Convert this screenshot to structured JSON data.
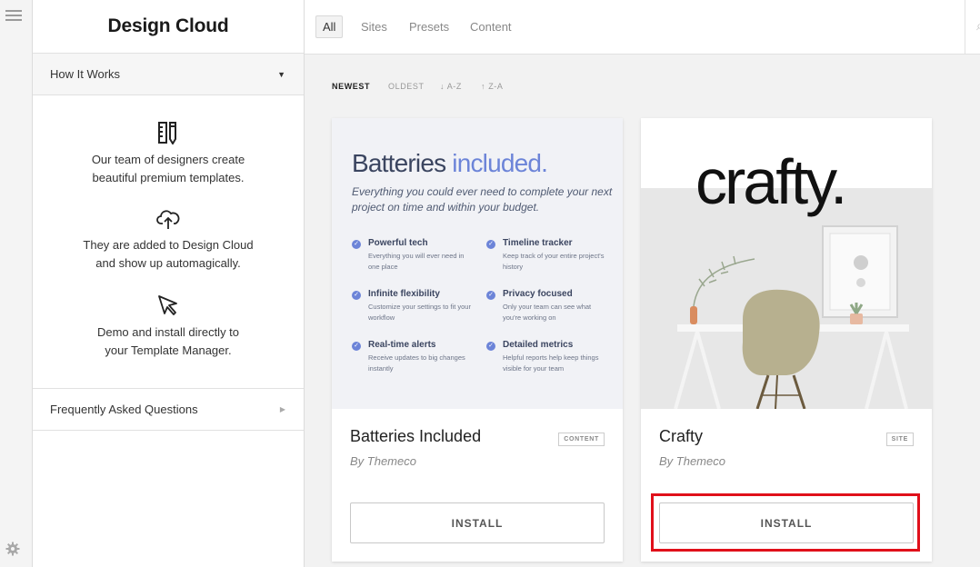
{
  "sidebar": {
    "title": "Design Cloud",
    "how_it_works": "How It Works",
    "steps": [
      {
        "icon": "ruler-pencil-icon",
        "text_line1": "Our team of designers create",
        "text_line2": "beautiful premium templates."
      },
      {
        "icon": "cloud-upload-icon",
        "text_line1": "They are added to Design Cloud",
        "text_line2": "and show up automagically."
      },
      {
        "icon": "cursor-arrow-icon",
        "text_line1": "Demo and install directly to",
        "text_line2": "your Template Manager."
      }
    ],
    "faq": "Frequently Asked Questions"
  },
  "filters": {
    "tabs": [
      "All",
      "Sites",
      "Presets",
      "Content"
    ],
    "active_tab": "All"
  },
  "sort": {
    "options": [
      "NEWEST",
      "OLDEST",
      "↓ A-Z",
      "↑ Z-A"
    ],
    "active": "NEWEST"
  },
  "cards": [
    {
      "title": "Batteries Included",
      "badge": "CONTENT",
      "author": "By Themeco",
      "button": "INSTALL",
      "preview": {
        "heading_part1": "Batteries",
        "heading_part2": "included.",
        "subheading": "Everything you could ever need to complete your next project on time and within your budget.",
        "features": [
          {
            "title": "Powerful tech",
            "desc": "Everything you will ever need in one place"
          },
          {
            "title": "Timeline tracker",
            "desc": "Keep track of your entire project's history"
          },
          {
            "title": "Infinite flexibility",
            "desc": "Customize your settings to fit your workflow"
          },
          {
            "title": "Privacy focused",
            "desc": "Only your team can see what you're working on"
          },
          {
            "title": "Real-time alerts",
            "desc": "Receive updates to big changes instantly"
          },
          {
            "title": "Detailed metrics",
            "desc": "Helpful reports help keep things visible for your team"
          }
        ]
      }
    },
    {
      "title": "Crafty",
      "badge": "SITE",
      "author": "By Themeco",
      "button": "INSTALL",
      "preview": {
        "wordmark": "crafty."
      }
    }
  ],
  "colors": {
    "accent_blue": "#6c84d8",
    "highlight_red": "#e0101a"
  }
}
